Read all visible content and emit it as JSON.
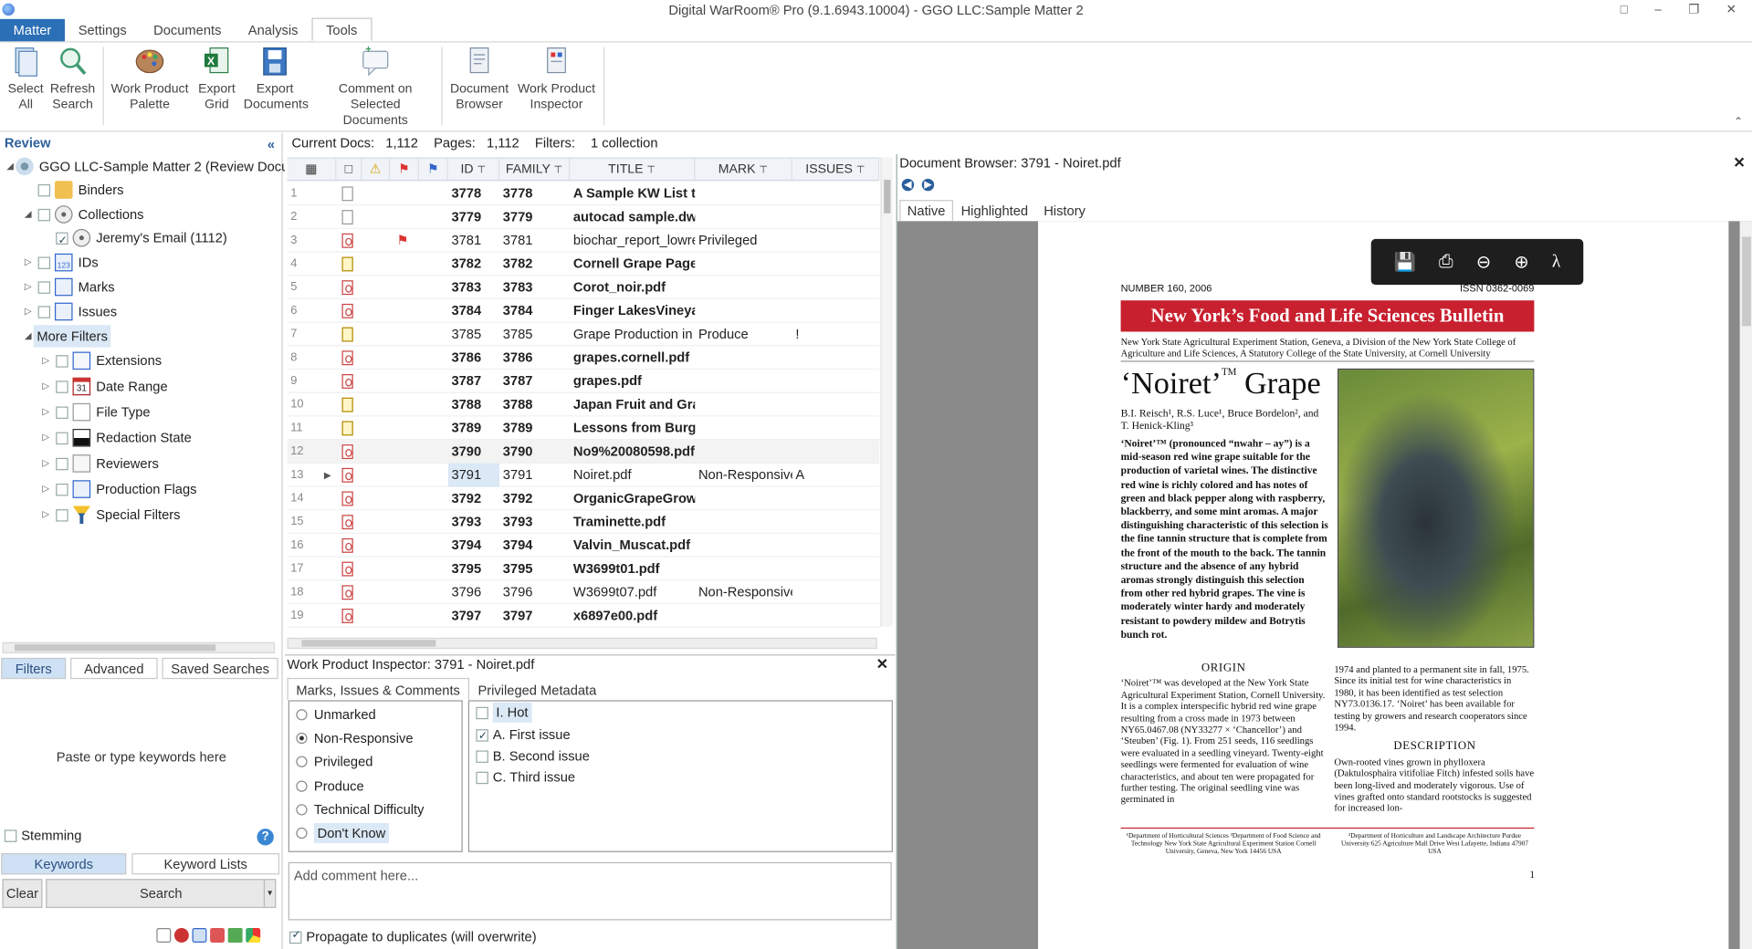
{
  "window": {
    "title": "Digital WarRoom® Pro (9.1.6943.10004) - GGO LLC:Sample Matter 2"
  },
  "ribbon_tabs": [
    "Matter",
    "Settings",
    "Documents",
    "Analysis",
    "Tools"
  ],
  "ribbon": {
    "select_all": [
      "Select",
      "All"
    ],
    "refresh_search": [
      "Refresh",
      "Search"
    ],
    "work_product_palette": [
      "Work Product",
      "Palette"
    ],
    "export_grid": [
      "Export",
      "Grid"
    ],
    "export_documents": [
      "Export",
      "Documents"
    ],
    "comment_selected": [
      "Comment on",
      "Selected Documents"
    ],
    "document_browser": [
      "Document",
      "Browser"
    ],
    "work_product_inspector": [
      "Work Product",
      "Inspector"
    ]
  },
  "left": {
    "title": "Review",
    "root": "GGO LLC-Sample Matter 2 (Review Docum",
    "nodes": {
      "binders": "Binders",
      "collections": "Collections",
      "jeremy": "Jeremy's Email (1112)",
      "ids": "IDs",
      "marks": "Marks",
      "issues": "Issues",
      "more_filters": "More Filters",
      "extensions": "Extensions",
      "date_range": "Date Range",
      "file_type": "File Type",
      "redaction_state": "Redaction State",
      "reviewers": "Reviewers",
      "production_flags": "Production Flags",
      "special_filters": "Special Filters"
    },
    "tabs": [
      "Filters",
      "Advanced",
      "Saved Searches"
    ],
    "keyword_placeholder": "Paste or type keywords here",
    "stemming": "Stemming",
    "kw_tabs": [
      "Keywords",
      "Keyword Lists"
    ],
    "clear": "Clear",
    "search": "Search"
  },
  "grid": {
    "current_docs_label": "Current Docs:",
    "current_docs": "1,112",
    "pages_label": "Pages:",
    "pages": "1,112",
    "filters_label": "Filters:",
    "filters": "1 collection",
    "columns": [
      "ID",
      "FAMILY",
      "TITLE",
      "MARK",
      "ISSUES"
    ],
    "rows": [
      {
        "n": "1",
        "id": "3778",
        "family": "3778",
        "title": "A Sample KW List t",
        "mark": "",
        "issues": "",
        "bold": true,
        "ic": "doc"
      },
      {
        "n": "2",
        "id": "3779",
        "family": "3779",
        "title": "autocad sample.dw",
        "mark": "",
        "issues": "",
        "bold": true,
        "ic": "doc"
      },
      {
        "n": "3",
        "id": "3781",
        "family": "3781",
        "title": "biochar_report_lowre",
        "mark": "Privileged",
        "issues": "",
        "bold": false,
        "ic": "p",
        "flag": true
      },
      {
        "n": "4",
        "id": "3782",
        "family": "3782",
        "title": "Cornell Grape Page",
        "mark": "",
        "issues": "",
        "bold": true,
        "ic": "z"
      },
      {
        "n": "5",
        "id": "3783",
        "family": "3783",
        "title": "Corot_noir.pdf",
        "mark": "",
        "issues": "",
        "bold": true,
        "ic": "p"
      },
      {
        "n": "6",
        "id": "3784",
        "family": "3784",
        "title": "Finger LakesVineya",
        "mark": "",
        "issues": "",
        "bold": true,
        "ic": "p"
      },
      {
        "n": "7",
        "id": "3785",
        "family": "3785",
        "title": "Grape Production in",
        "mark": "Produce",
        "issues": "!",
        "bold": false,
        "ic": "z"
      },
      {
        "n": "8",
        "id": "3786",
        "family": "3786",
        "title": "grapes.cornell.pdf",
        "mark": "",
        "issues": "",
        "bold": true,
        "ic": "p"
      },
      {
        "n": "9",
        "id": "3787",
        "family": "3787",
        "title": "grapes.pdf",
        "mark": "",
        "issues": "",
        "bold": true,
        "ic": "p"
      },
      {
        "n": "10",
        "id": "3788",
        "family": "3788",
        "title": "Japan Fruit and Gra",
        "mark": "",
        "issues": "",
        "bold": true,
        "ic": "z"
      },
      {
        "n": "11",
        "id": "3789",
        "family": "3789",
        "title": "Lessons from Burgu",
        "mark": "",
        "issues": "",
        "bold": true,
        "ic": "z"
      },
      {
        "n": "12",
        "id": "3790",
        "family": "3790",
        "title": "No9%20080598.pdf",
        "mark": "",
        "issues": "",
        "bold": true,
        "ic": "p",
        "sel": true
      },
      {
        "n": "13",
        "id": "3791",
        "family": "3791",
        "title": "Noiret.pdf",
        "mark": "Non-Responsive",
        "issues": "A",
        "bold": false,
        "ic": "p",
        "current": true
      },
      {
        "n": "14",
        "id": "3792",
        "family": "3792",
        "title": "OrganicGrapeGrowi",
        "mark": "",
        "issues": "",
        "bold": true,
        "ic": "p"
      },
      {
        "n": "15",
        "id": "3793",
        "family": "3793",
        "title": "Traminette.pdf",
        "mark": "",
        "issues": "",
        "bold": true,
        "ic": "p"
      },
      {
        "n": "16",
        "id": "3794",
        "family": "3794",
        "title": "Valvin_Muscat.pdf",
        "mark": "",
        "issues": "",
        "bold": true,
        "ic": "p"
      },
      {
        "n": "17",
        "id": "3795",
        "family": "3795",
        "title": "W3699t01.pdf",
        "mark": "",
        "issues": "",
        "bold": true,
        "ic": "p"
      },
      {
        "n": "18",
        "id": "3796",
        "family": "3796",
        "title": "W3699t07.pdf",
        "mark": "Non-Responsive",
        "issues": "",
        "bold": false,
        "ic": "p"
      },
      {
        "n": "19",
        "id": "3797",
        "family": "3797",
        "title": "x6897e00.pdf",
        "mark": "",
        "issues": "",
        "bold": true,
        "ic": "p"
      }
    ]
  },
  "inspector": {
    "title": "Work Product Inspector: 3791 - Noiret.pdf",
    "tabs": [
      "Marks, Issues & Comments",
      "Privileged Metadata"
    ],
    "marks": [
      "Unmarked",
      "Non-Responsive",
      "Privileged",
      "Produce",
      "Technical Difficulty",
      "Don't Know"
    ],
    "selected_mark": "Non-Responsive",
    "issues": [
      "I. Hot",
      "A. First issue",
      "B. Second issue",
      "C. Third issue"
    ],
    "comment_placeholder": "Add comment here...",
    "propagate": "Propagate to duplicates (will overwrite)"
  },
  "browser": {
    "title": "Document Browser: 3791 - Noiret.pdf",
    "tabs": [
      "Native",
      "Highlighted",
      "History"
    ],
    "doc": {
      "number": "NUMBER 160, 2006",
      "issn": "ISSN 0362-0069",
      "banner": "New York’s Food and Life Sciences Bulletin",
      "sub": "New York State Agricultural Experiment Station, Geneva, a Division of the New York State College of Agriculture and Life Sciences, A Statutory College of the State University, at Cornell University",
      "title_main": "‘Noiret’",
      "title_tm": "TM",
      "title_end": " Grape",
      "authors": "B.I. Reisch¹, R.S. Luce¹, Bruce Bordelon², and T. Henick-Kling³",
      "abstract": "‘Noiret’™ (pronounced “nwahr – ay”) is a mid-season red wine grape suitable for the production of varietal wines. The distinctive red wine is richly colored and has notes of green and black pepper along with raspberry, blackberry, and some mint aromas. A major distinguishing characteristic of this selection is the fine tannin structure that is complete from the front of the mouth to the back. The tannin structure and the absence of any hybrid aromas strongly distinguish this selection from other red hybrid grapes. The vine is moderately winter hardy and moderately resistant to powdery mildew and Botrytis bunch rot.",
      "origin_h": "ORIGIN",
      "origin": "‘Noiret’™ was developed at the New York State Agricultural Experiment Station, Cornell University. It is a complex interspecific hybrid red wine grape resulting from a cross made in 1973 between NY65.0467.08 (NY33277 × ‘Chancellor’) and ‘Steuben’ (Fig. 1). From 251 seeds, 116 seedlings were evaluated in a seedling vineyard. Twenty-eight seedlings were fermented for evaluation of wine characteristics, and about ten were propagated for further testing. The original seedling vine was germinated in",
      "col2": "1974 and planted to a permanent site in fall, 1975. Since its initial test for wine characteristics in 1980, it has been identified as test selection NY73.0136.17. ‘Noiret’ has been available for testing by growers and research cooperators since 1994.",
      "desc_h": "DESCRIPTION",
      "desc": "Own-rooted vines grown in phylloxera (Daktulosphaira vitifoliae Fitch) infested soils have been long-lived and moderately vigorous. Use of vines grafted onto standard rootstocks is suggested for increased lon-",
      "fn1": "¹Department of Horticultural Sciences ³Department of Food Science and Technology New York State Agricultural Experiment Station Cornell University, Geneva, New York 14456 USA",
      "fn2": "²Department of Horticulture and Landscape Architecture Purdue University 625 Agriculture Mall Drive West Lafayette, Indiana 47907 USA",
      "page_no": "1"
    }
  }
}
